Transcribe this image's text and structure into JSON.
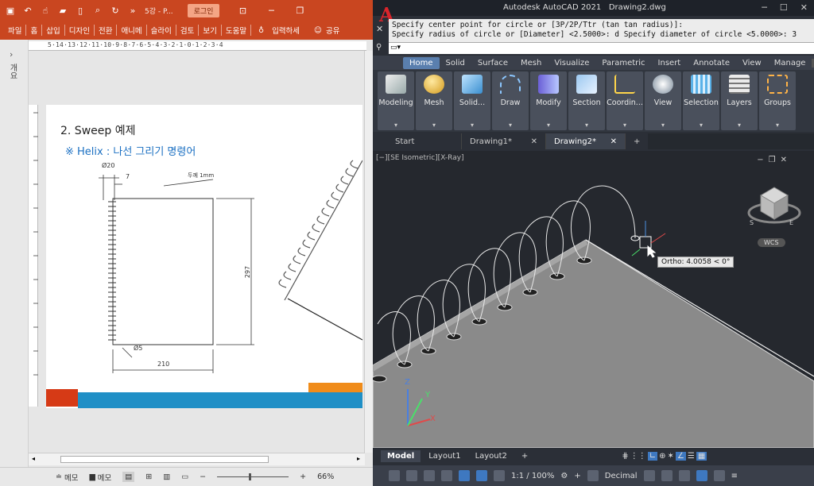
{
  "ppt": {
    "doc_title": "5강 - P...",
    "login_button": "로그인",
    "menu": [
      "파일",
      "홈",
      "삽입",
      "디자인",
      "전환",
      "애니메",
      "슬라이",
      "검토",
      "보기",
      "도움말"
    ],
    "tell_me": "입력하세",
    "share": "공유",
    "thumbnail_panel_label": "개요",
    "ruler_text": "5·14·13·12·11·10·9·8·7·6·5·4·3·2·1·0·1·2·3·4",
    "slide": {
      "heading": "2. Sweep 예제",
      "subheading": "※ Helix : 나선 그리기 명령어",
      "dim_diameter": "Ø20",
      "dim_pitch": "7",
      "dim_thickness": "두께 1mm",
      "dim_height": "297",
      "dim_hole": "Ø5",
      "dim_width": "210"
    },
    "status": {
      "notes": "메모",
      "comments": "메모",
      "zoom": "66%",
      "minus": "−",
      "plus": "+"
    }
  },
  "acad": {
    "app_title": "Autodesk AutoCAD 2021",
    "drawing_title": "Drawing2.dwg",
    "command_lines": [
      "Specify center point for circle or [3P/2P/Ttr (tan tan radius)]:",
      "Specify radius of circle or [Diameter] <2.5000>: d Specify diameter of circle <5.0000>: 3"
    ],
    "ribbon_tabs": [
      "Home",
      "Solid",
      "Surface",
      "Mesh",
      "Visualize",
      "Parametric",
      "Insert",
      "Annotate",
      "View",
      "Manage"
    ],
    "ribbon_panels": [
      "Modeling",
      "Mesh",
      "Solid...",
      "Draw",
      "Modify",
      "Section",
      "Coordin...",
      "View",
      "Selection",
      "Layers",
      "Groups"
    ],
    "doc_tabs": [
      "Start",
      "Drawing1*",
      "Drawing2*"
    ],
    "viewport_label": "[−][SE Isometric][X-Ray]",
    "ortho_tooltip": "Ortho: 4.0058 < 0°",
    "wcs_label": "WCS",
    "layout_tabs": [
      "Model",
      "Layout1",
      "Layout2"
    ],
    "status_scale": "1:1 / 100%",
    "status_units": "Decimal"
  },
  "colors": {
    "ppt_accent": "#c94620",
    "acad_bg": "#2b2f37",
    "ribbon_active": "#5a7fae",
    "slide_heading_blue": "#1a6fc2"
  }
}
